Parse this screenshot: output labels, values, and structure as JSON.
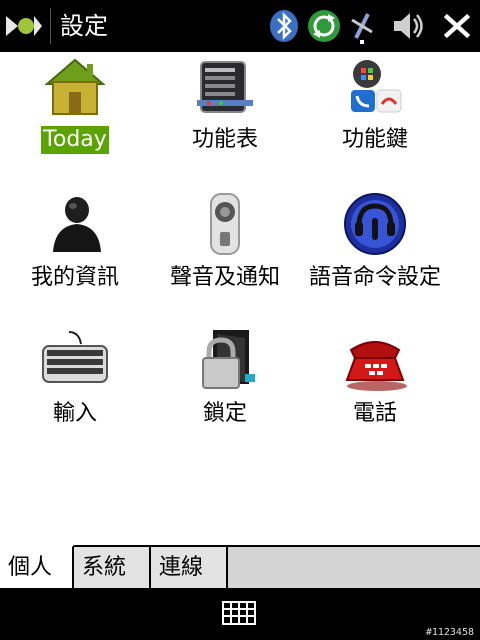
{
  "titlebar": {
    "title": "設定",
    "icons": [
      "windows-start-icon",
      "bluetooth-icon",
      "sync-icon",
      "signal-icon",
      "volume-icon",
      "close-icon"
    ]
  },
  "items": [
    {
      "label": "Today",
      "icon": "home-icon",
      "selected": true
    },
    {
      "label": "功能表",
      "icon": "menu-icon",
      "selected": false
    },
    {
      "label": "功能鍵",
      "icon": "buttons-icon",
      "selected": false
    },
    {
      "label": "我的資訊",
      "icon": "owner-icon",
      "selected": false
    },
    {
      "label": "聲音及通知",
      "icon": "sound-icon",
      "selected": false
    },
    {
      "label": "語音命令設定",
      "icon": "voice-command-icon",
      "selected": false
    },
    {
      "label": "輸入",
      "icon": "keyboard-icon",
      "selected": false
    },
    {
      "label": "鎖定",
      "icon": "lock-icon",
      "selected": false
    },
    {
      "label": "電話",
      "icon": "phone-icon",
      "selected": false
    }
  ],
  "tabs": [
    {
      "label": "個人",
      "active": true
    },
    {
      "label": "系統",
      "active": false
    },
    {
      "label": "連線",
      "active": false
    }
  ],
  "bottombar": {
    "icon": "keyboard-toggle-icon"
  },
  "watermark": "#1123458"
}
